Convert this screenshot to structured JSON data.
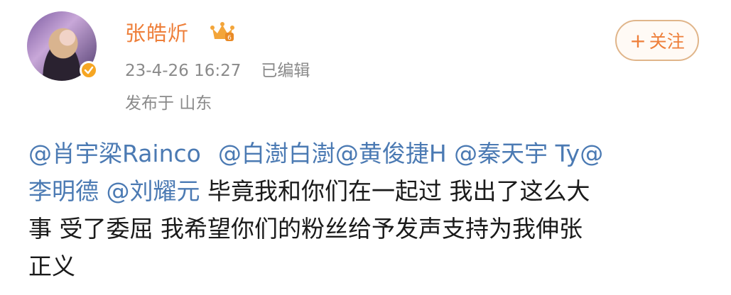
{
  "post": {
    "author": "张皓炘",
    "timestamp": "23-4-26 16:27",
    "edited_label": "已编辑",
    "location": "发布于 山东",
    "follow_label": "关注",
    "follow_plus": "+",
    "mentions": [
      "@肖宇梁Rainco",
      "@白澍白澍",
      "@黄俊捷H",
      "@秦天宇 Ty@",
      "李明德",
      "@刘耀元"
    ],
    "text_segments": [
      "毕竟我和你们在一起过 我出了这么大",
      "事 受了委屈 我希望你们的粉丝给予发声支持为我伸张",
      "正义"
    ]
  },
  "icons": {
    "avatar": "avatar-image",
    "verified": "verified-badge-icon",
    "vip": "crown-icon"
  },
  "colors": {
    "name": "#ee7f3a",
    "mention": "#4b7ab3",
    "meta": "#8a8a8a",
    "follow_border": "#e0b58a",
    "verified": "#f6a623"
  }
}
